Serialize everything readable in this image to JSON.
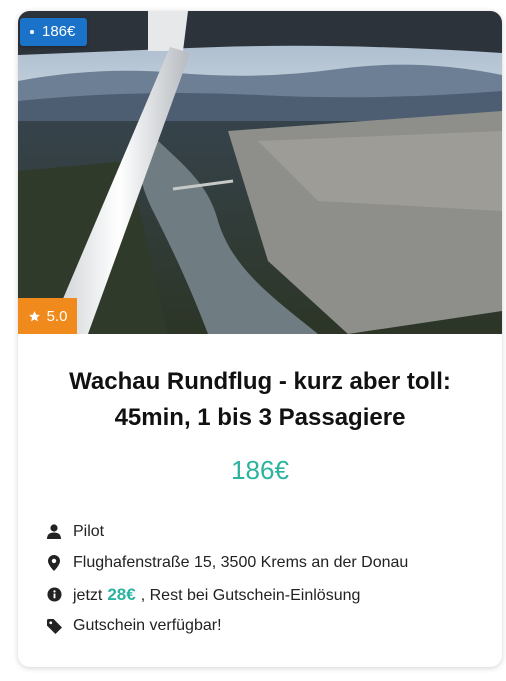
{
  "badge": {
    "price": "186€"
  },
  "rating": {
    "value": "5.0",
    "icon": "star-icon"
  },
  "offer": {
    "title_line1": "Wachau Rundflug - kurz aber toll:",
    "title_line2": "45min, 1 bis 3 Passagiere",
    "price": "186€"
  },
  "details": {
    "pilot": "Pilot",
    "address": "Flughafenstraße 15, 3500 Krems an der Donau",
    "deposit_prefix": "jetzt",
    "deposit_amount": "28€",
    "deposit_suffix": ", Rest bei Gutschein-Einlösung",
    "voucher": "Gutschein verfügbar!"
  },
  "colors": {
    "badge_blue": "#1a73c9",
    "rating_orange": "#f08a1c",
    "accent_teal": "#2bb3a0"
  }
}
